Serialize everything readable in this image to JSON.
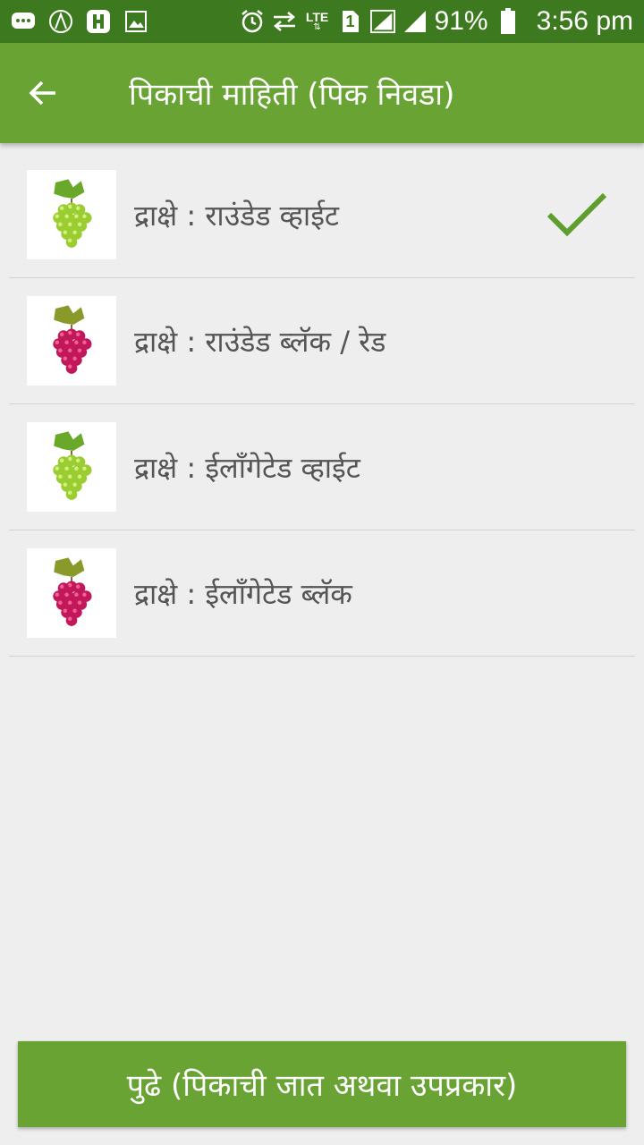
{
  "status_bar": {
    "battery": "91%",
    "time": "3:56 pm",
    "network_label": "LTE",
    "sim_slot": "1",
    "icons": [
      "chat-icon",
      "a-logo-icon",
      "app-icon",
      "image-icon",
      "alarm-icon",
      "data-transfer-icon",
      "signal-icon",
      "battery-icon"
    ]
  },
  "app_bar": {
    "title": "पिकाची माहिती (पिक निवडा)",
    "back_icon": "arrow-left-icon"
  },
  "crops": [
    {
      "label": "द्राक्षे : राउंडेड व्हाईट",
      "grape_color": "green",
      "selected": true
    },
    {
      "label": "द्राक्षे : राउंडेड ब्लॅक / रेड",
      "grape_color": "red",
      "selected": false
    },
    {
      "label": "द्राक्षे : ईलॉंगेटेड व्हाईट",
      "grape_color": "green",
      "selected": false
    },
    {
      "label": "द्राक्षे : ईलॉंगेटेड ब्लॅक",
      "grape_color": "red",
      "selected": false
    }
  ],
  "next_button": {
    "label": "पुढे (पिकाची जात अथवा उपप्रकार)"
  },
  "colors": {
    "status_bar": "#3d7a1f",
    "app_bar": "#68a334",
    "check": "#5d9e2f",
    "background": "#eeeeee"
  }
}
